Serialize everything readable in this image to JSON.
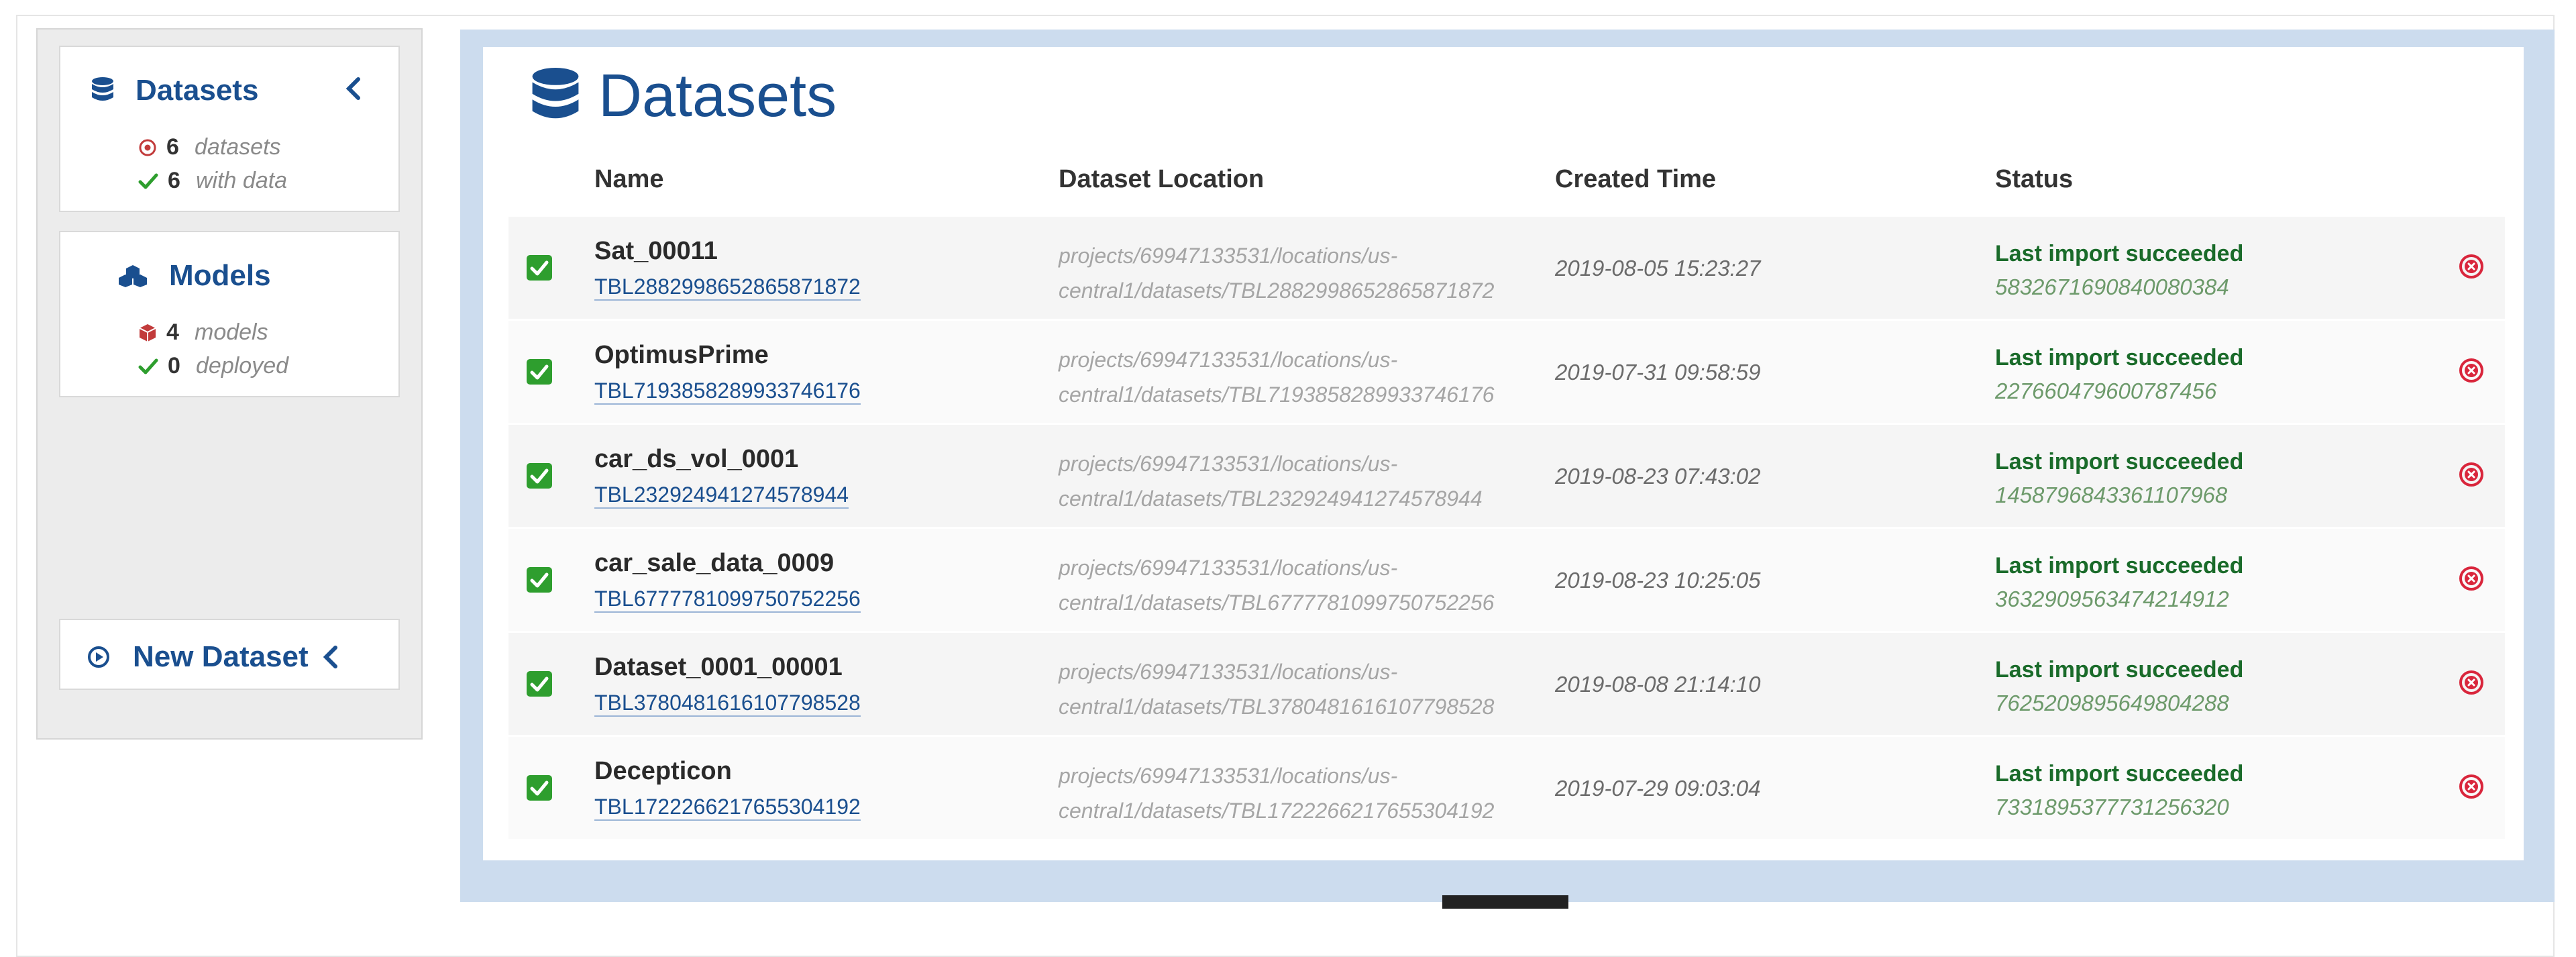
{
  "colors": {
    "brand_blue": "#1a4f8f",
    "frame_blue": "#ccdcee",
    "success_green": "#1a6b2a",
    "checkbox_green": "#2e9e2e",
    "delete_red": "#d9263c"
  },
  "sidebar": {
    "datasets": {
      "label": "Datasets",
      "icon": "database-icon",
      "stats": [
        {
          "icon": "target-icon",
          "count": "6",
          "label": "datasets"
        },
        {
          "icon": "check-icon",
          "count": "6",
          "label": "with data"
        }
      ]
    },
    "models": {
      "label": "Models",
      "icon": "cubes-icon",
      "stats": [
        {
          "icon": "cube-icon",
          "count": "4",
          "label": "models"
        },
        {
          "icon": "check-icon",
          "count": "0",
          "label": "deployed"
        }
      ]
    },
    "new_dataset": {
      "label": "New Dataset",
      "icon": "play-circle-icon"
    }
  },
  "main": {
    "title": "Datasets",
    "columns": [
      "Name",
      "Dataset Location",
      "Created Time",
      "Status"
    ],
    "rows": [
      {
        "name": "Sat_00011",
        "id": "TBL2882998652865871872",
        "loc1": "projects/69947133531/locations/us-",
        "loc2": "central1/datasets/TBL2882998652865871872",
        "created": "2019-08-05 15:23:27",
        "status": "Last import succeeded",
        "status_id": "5832671690840080384"
      },
      {
        "name": "OptimusPrime",
        "id": "TBL7193858289933746176",
        "loc1": "projects/69947133531/locations/us-",
        "loc2": "central1/datasets/TBL7193858289933746176",
        "created": "2019-07-31 09:58:59",
        "status": "Last import succeeded",
        "status_id": "227660479600787456"
      },
      {
        "name": "car_ds_vol_0001",
        "id": "TBL232924941274578944",
        "loc1": "projects/69947133531/locations/us-",
        "loc2": "central1/datasets/TBL232924941274578944",
        "created": "2019-08-23 07:43:02",
        "status": "Last import succeeded",
        "status_id": "1458796843361107968"
      },
      {
        "name": "car_sale_data_0009",
        "id": "TBL6777781099750752256",
        "loc1": "projects/69947133531/locations/us-",
        "loc2": "central1/datasets/TBL6777781099750752256",
        "created": "2019-08-23 10:25:05",
        "status": "Last import succeeded",
        "status_id": "3632909563474214912"
      },
      {
        "name": "Dataset_0001_00001",
        "id": "TBL3780481616107798528",
        "loc1": "projects/69947133531/locations/us-",
        "loc2": "central1/datasets/TBL3780481616107798528",
        "created": "2019-08-08 21:14:10",
        "status": "Last import succeeded",
        "status_id": "7625209895649804288"
      },
      {
        "name": "Decepticon",
        "id": "TBL1722266217655304192",
        "loc1": "projects/69947133531/locations/us-",
        "loc2": "central1/datasets/TBL1722266217655304192",
        "created": "2019-07-29 09:03:04",
        "status": "Last import succeeded",
        "status_id": "7331895377731256320"
      }
    ]
  }
}
